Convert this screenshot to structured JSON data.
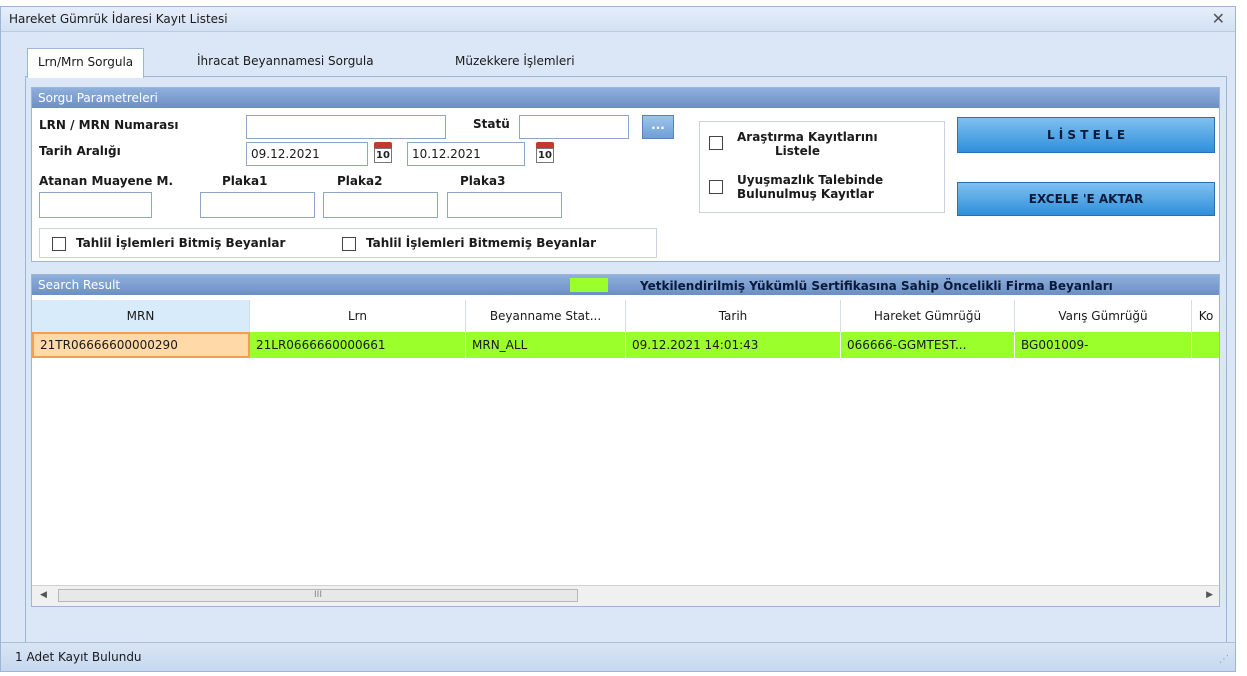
{
  "window": {
    "title": "Hareket Gümrük İdaresi Kayıt Listesi",
    "close_glyph": "✕"
  },
  "tabs": [
    "Lrn/Mrn Sorgula",
    "İhracat Beyannamesi Sorgula",
    "Müzekkere İşlemleri"
  ],
  "params": {
    "header": "Sorgu Parametreleri",
    "lrn_label": "LRN / MRN Numarası",
    "lrn_value": "",
    "statu_label": "Statü",
    "statu_value": "",
    "dots_label": "...",
    "date_label": "Tarih Aralığı",
    "date_from": "09.12.2021",
    "date_to": "10.12.2021",
    "cal_day": "10",
    "atanan_label": "Atanan Muayene M.",
    "plaka1_label": "Plaka1",
    "plaka2_label": "Plaka2",
    "plaka3_label": "Plaka3",
    "chk_tahlil_bitmis": "Tahlil İşlemleri Bitmiş Beyanlar",
    "chk_tahlil_bitmemis": "Tahlil İşlemleri Bitmemiş Beyanlar",
    "chk_arastirma_1": "Araştırma Kayıtlarını",
    "chk_arastirma_2": "Listele",
    "chk_uyusmazlik_1": "Uyuşmazlık Talebinde",
    "chk_uyusmazlik_2": "Bulunulmuş Kayıtlar",
    "listele_button": "L İ S T E L E",
    "excel_button": "EXCELE 'E AKTAR"
  },
  "results": {
    "header": "Search Result",
    "legend_text": "Yetkilendirilmiş Yükümlü Sertifikasına Sahip Öncelikli Firma Beyanları",
    "legend_color": "#9aff2a",
    "columns": [
      "MRN",
      "Lrn",
      "Beyanname Stat...",
      "Tarih",
      "Hareket Gümrüğü",
      "Varış Gümrüğü",
      "Ko"
    ],
    "rows": [
      [
        "21TR06666600000290",
        "21LR0666660000661",
        "MRN_ALL",
        "09.12.2021 14:01:43",
        "066666-GGMTEST...",
        "BG001009-",
        ""
      ]
    ],
    "scroll_thumb": "III"
  },
  "status": {
    "text": "1  Adet Kayıt Bulundu"
  }
}
